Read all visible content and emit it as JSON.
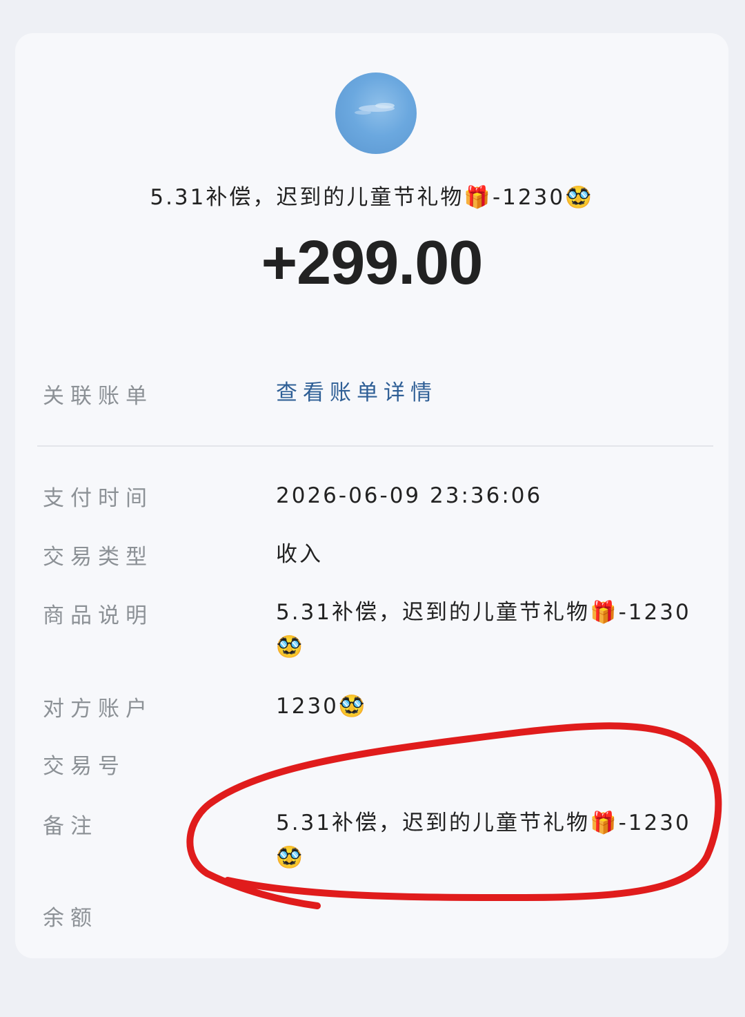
{
  "header": {
    "counterparty_name": "5.31补偿，迟到的儿童节礼物🎁-1230🥸",
    "amount": "+299.00"
  },
  "linked_bill": {
    "label": "关联账单",
    "link_text": "查看账单详情"
  },
  "details": [
    {
      "label": "支付时间",
      "value": "2026-06-09 23:36:06"
    },
    {
      "label": "交易类型",
      "value": "收入"
    },
    {
      "label": "商品说明",
      "value": "5.31补偿，迟到的儿童节礼物🎁-1230🥸"
    },
    {
      "label": "对方账户",
      "value": "1230🥸"
    },
    {
      "label": "交易号",
      "value": ""
    },
    {
      "label": "备注",
      "value": "5.31补偿，迟到的儿童节礼物🎁-1230🥸"
    },
    {
      "label": "余额",
      "value": ""
    }
  ],
  "annotation": {
    "color": "#e01c1c"
  }
}
